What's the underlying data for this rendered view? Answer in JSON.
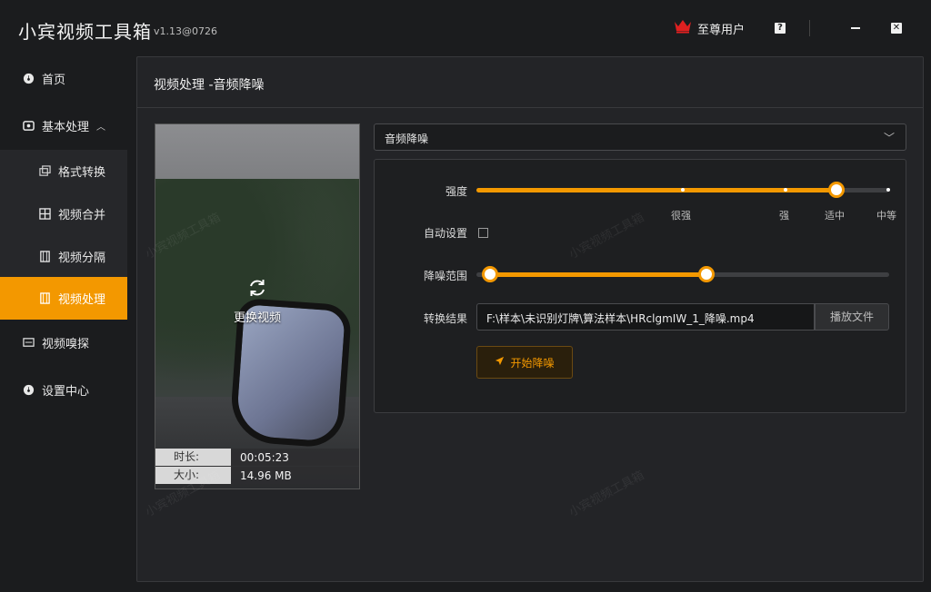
{
  "app": {
    "title": "小宾视频工具箱",
    "version": "v1.13@0726"
  },
  "titlebar": {
    "vip_label": "至尊用户",
    "help_glyph": "?",
    "close_glyph": "✕"
  },
  "sidebar": {
    "items": [
      {
        "label": "首页"
      },
      {
        "label": "基本处理",
        "chevron": "^"
      },
      {
        "label": "格式转换"
      },
      {
        "label": "视频合并"
      },
      {
        "label": "视频分隔"
      },
      {
        "label": "视频处理"
      },
      {
        "label": "视频嗅探"
      },
      {
        "label": "设置中心"
      }
    ]
  },
  "page": {
    "title": "视频处理 -音频降噪"
  },
  "preview": {
    "replace_label": "更换视频",
    "duration_key": "时长:",
    "duration_value": "00:05:23",
    "size_key": "大小:",
    "size_value": "14.96 MB"
  },
  "mode_select": {
    "value": "音频降噪"
  },
  "settings": {
    "strength_label": "强度",
    "strength_marks": [
      "很强",
      "强",
      "适中",
      "中等"
    ],
    "strength_value": "适中",
    "auto_label": "自动设置",
    "auto_checked": false,
    "range_label": "降噪范围",
    "result_label": "转换结果",
    "result_path": "F:\\样本\\未识别灯牌\\算法样本\\HRclgmIW_1_降噪.mp4",
    "play_button": "播放文件",
    "start_button": "开始降噪"
  },
  "watermark": "小宾视频工具箱",
  "colors": {
    "accent": "#f39800",
    "background": "#1b1c1e",
    "panel": "#232427"
  }
}
